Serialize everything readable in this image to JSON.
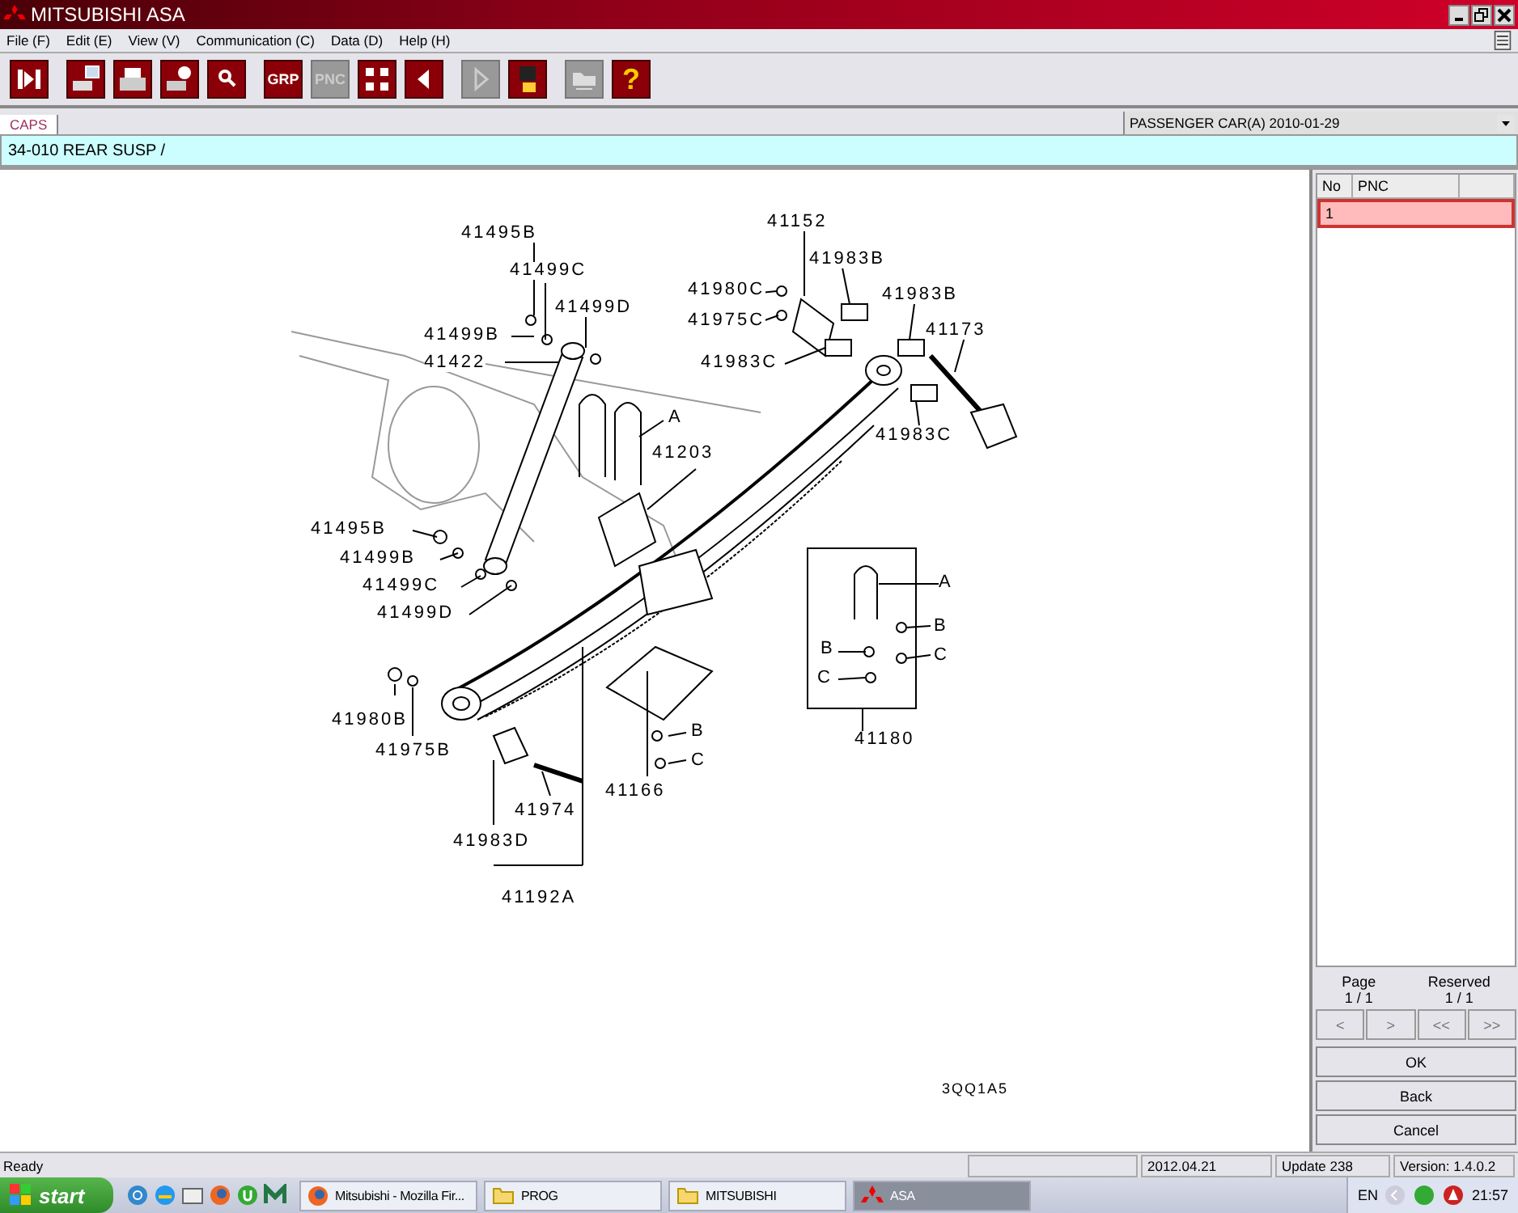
{
  "window": {
    "title": "MITSUBISHI ASA"
  },
  "menu": [
    "File (F)",
    "Edit (E)",
    "View (V)",
    "Communication (C)",
    "Data (D)",
    "Help (H)"
  ],
  "toolbar": [
    {
      "kind": "exit",
      "disabled": false
    },
    {
      "kind": "print-screen",
      "disabled": false
    },
    {
      "kind": "print",
      "disabled": false
    },
    {
      "kind": "print-preview",
      "disabled": false
    },
    {
      "kind": "zoom",
      "disabled": false
    },
    {
      "kind": "text",
      "label": "GRP",
      "disabled": false
    },
    {
      "kind": "text",
      "label": "PNC",
      "disabled": true
    },
    {
      "kind": "grid",
      "disabled": false
    },
    {
      "kind": "prev",
      "disabled": false
    },
    {
      "kind": "next",
      "disabled": true
    },
    {
      "kind": "save",
      "disabled": false
    },
    {
      "kind": "open",
      "disabled": true
    },
    {
      "kind": "text",
      "label": "?",
      "disabled": false
    }
  ],
  "tabs": [
    {
      "label": "CAPS",
      "selected": true
    }
  ],
  "vehicle_select": {
    "value": "PASSENGER CAR(A)  2010-01-29"
  },
  "breadcrumb": "34-010  REAR SUSP /",
  "diagram": {
    "callouts": [
      {
        "label": "41495B"
      },
      {
        "label": "41499C"
      },
      {
        "label": "41499D"
      },
      {
        "label": "41499B"
      },
      {
        "label": "41422"
      },
      {
        "label": "A"
      },
      {
        "label": "41203"
      },
      {
        "label": "41495B"
      },
      {
        "label": "41499B"
      },
      {
        "label": "41499C"
      },
      {
        "label": "41499D"
      },
      {
        "label": "41152"
      },
      {
        "label": "41983B"
      },
      {
        "label": "41980C"
      },
      {
        "label": "41975C"
      },
      {
        "label": "41983C"
      },
      {
        "label": "41983B"
      },
      {
        "label": "41173"
      },
      {
        "label": "41983C"
      },
      {
        "label": "A"
      },
      {
        "label": "B"
      },
      {
        "label": "B"
      },
      {
        "label": "C"
      },
      {
        "label": "C"
      },
      {
        "label": "41180"
      },
      {
        "label": "41980B"
      },
      {
        "label": "41975B"
      },
      {
        "label": "B"
      },
      {
        "label": "C"
      },
      {
        "label": "41166"
      },
      {
        "label": "41974"
      },
      {
        "label": "41983D"
      },
      {
        "label": "41192A"
      }
    ],
    "code": "3QQ1A5"
  },
  "parts_table": {
    "columns": [
      "No",
      "PNC"
    ],
    "rows": [
      {
        "no": "1",
        "pnc": "",
        "selected": true
      }
    ]
  },
  "paging": {
    "page_label": "Page",
    "page": "1 / 1",
    "reserved_label": "Reserved",
    "reserved": "1 / 1",
    "nav": [
      {
        "label": "<",
        "disabled": true
      },
      {
        "label": ">",
        "disabled": true
      },
      {
        "label": "<<",
        "disabled": true
      },
      {
        "label": ">>",
        "disabled": true
      }
    ]
  },
  "buttons": [
    "OK",
    "Back",
    "Cancel"
  ],
  "status_bar": {
    "message": "Ready",
    "date": "2012.04.21",
    "update": "Update 238",
    "version": "Version: 1.4.0.2"
  },
  "taskbar": {
    "start": "start",
    "tasks": [
      {
        "label": "Mitsubishi - Mozilla Fir...",
        "kind": "browser",
        "selected": false
      },
      {
        "label": "PROG",
        "kind": "folder",
        "selected": false
      },
      {
        "label": "MITSUBISHI",
        "kind": "folder",
        "selected": false
      },
      {
        "label": "ASA",
        "kind": "app",
        "selected": true
      }
    ],
    "language": "EN",
    "clock": "21:57"
  }
}
